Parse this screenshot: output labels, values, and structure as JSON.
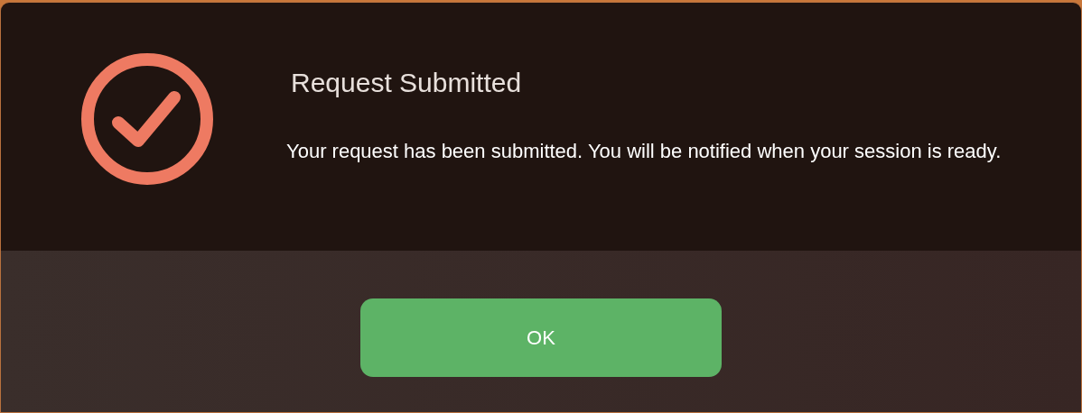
{
  "dialog": {
    "title": "Request Submitted",
    "message": "Your request has been submitted. You will be notified when your session is ready.",
    "buttons": [
      {
        "label": "OK",
        "kind": "primary"
      }
    ]
  }
}
